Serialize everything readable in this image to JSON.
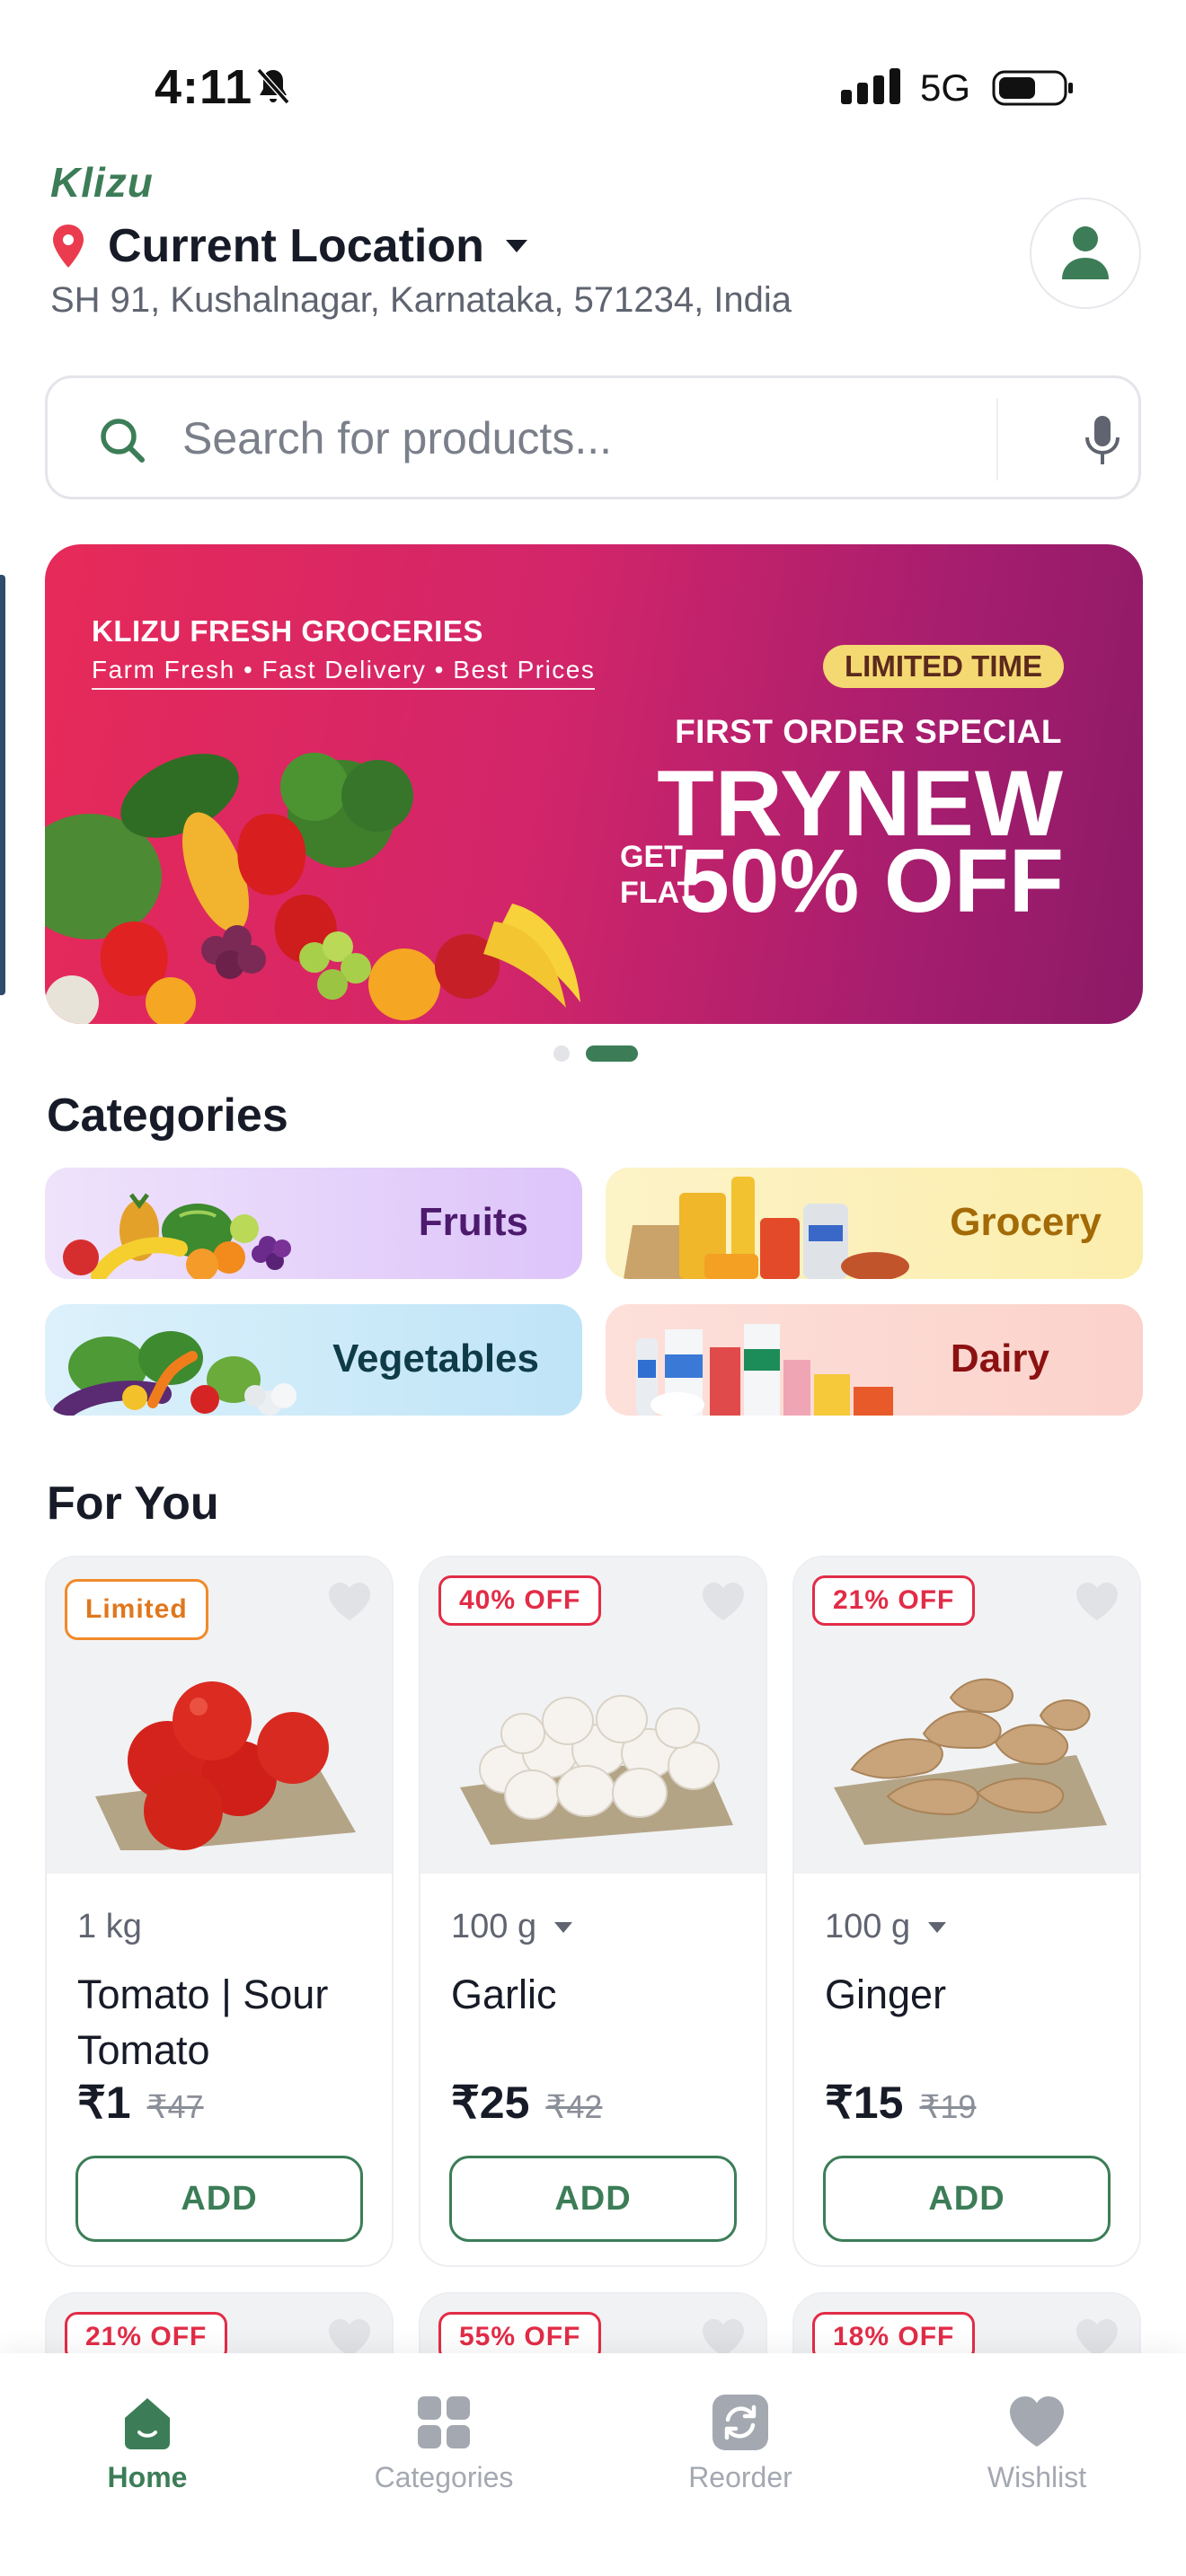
{
  "status_bar": {
    "time": "4:11",
    "network": "5G"
  },
  "header": {
    "brand": "Klizu",
    "location_title": "Current Location",
    "address": "SH 91, Kushalnagar, Karnataka, 571234, India"
  },
  "search": {
    "placeholder": "Search for products..."
  },
  "banner": {
    "brand": "KLIZU FRESH GROCERIES",
    "tagline": "Farm Fresh • Fast Delivery • Best Prices",
    "pill": "LIMITED TIME",
    "offer_title": "FIRST ORDER SPECIAL",
    "code": "TRYNEW",
    "get": "GET",
    "flat": "FLAT",
    "discount": "50% OFF",
    "slide_count": 2,
    "active_slide": 2
  },
  "categories": {
    "title": "Categories",
    "items": [
      {
        "label": "Fruits"
      },
      {
        "label": "Grocery"
      },
      {
        "label": "Vegetables"
      },
      {
        "label": "Dairy"
      }
    ]
  },
  "for_you": {
    "title": "For You",
    "products": [
      {
        "badge": "Limited",
        "weight": "1 kg",
        "name": "Tomato | Sour Tomato",
        "price": "₹1",
        "mrp": "₹47",
        "add": "ADD"
      },
      {
        "badge": "40% OFF",
        "weight": "100 g",
        "name": "Garlic",
        "price": "₹25",
        "mrp": "₹42",
        "add": "ADD"
      },
      {
        "badge": "21% OFF",
        "weight": "100 g",
        "name": "Ginger",
        "price": "₹15",
        "mrp": "₹19",
        "add": "ADD"
      }
    ],
    "next_row_badges": [
      "21% OFF",
      "55% OFF",
      "18% OFF"
    ]
  },
  "bottom_nav": [
    {
      "label": "Home",
      "icon": "home-icon",
      "active": true
    },
    {
      "label": "Categories",
      "icon": "grid-icon",
      "active": false
    },
    {
      "label": "Reorder",
      "icon": "reorder-icon",
      "active": false
    },
    {
      "label": "Wishlist",
      "icon": "heart-icon",
      "active": false
    }
  ],
  "colors": {
    "brand_green": "#3c7d57",
    "offer_red": "#e22c47",
    "banner_pink": "#e72a59",
    "banner_purple": "#8c1a66"
  }
}
